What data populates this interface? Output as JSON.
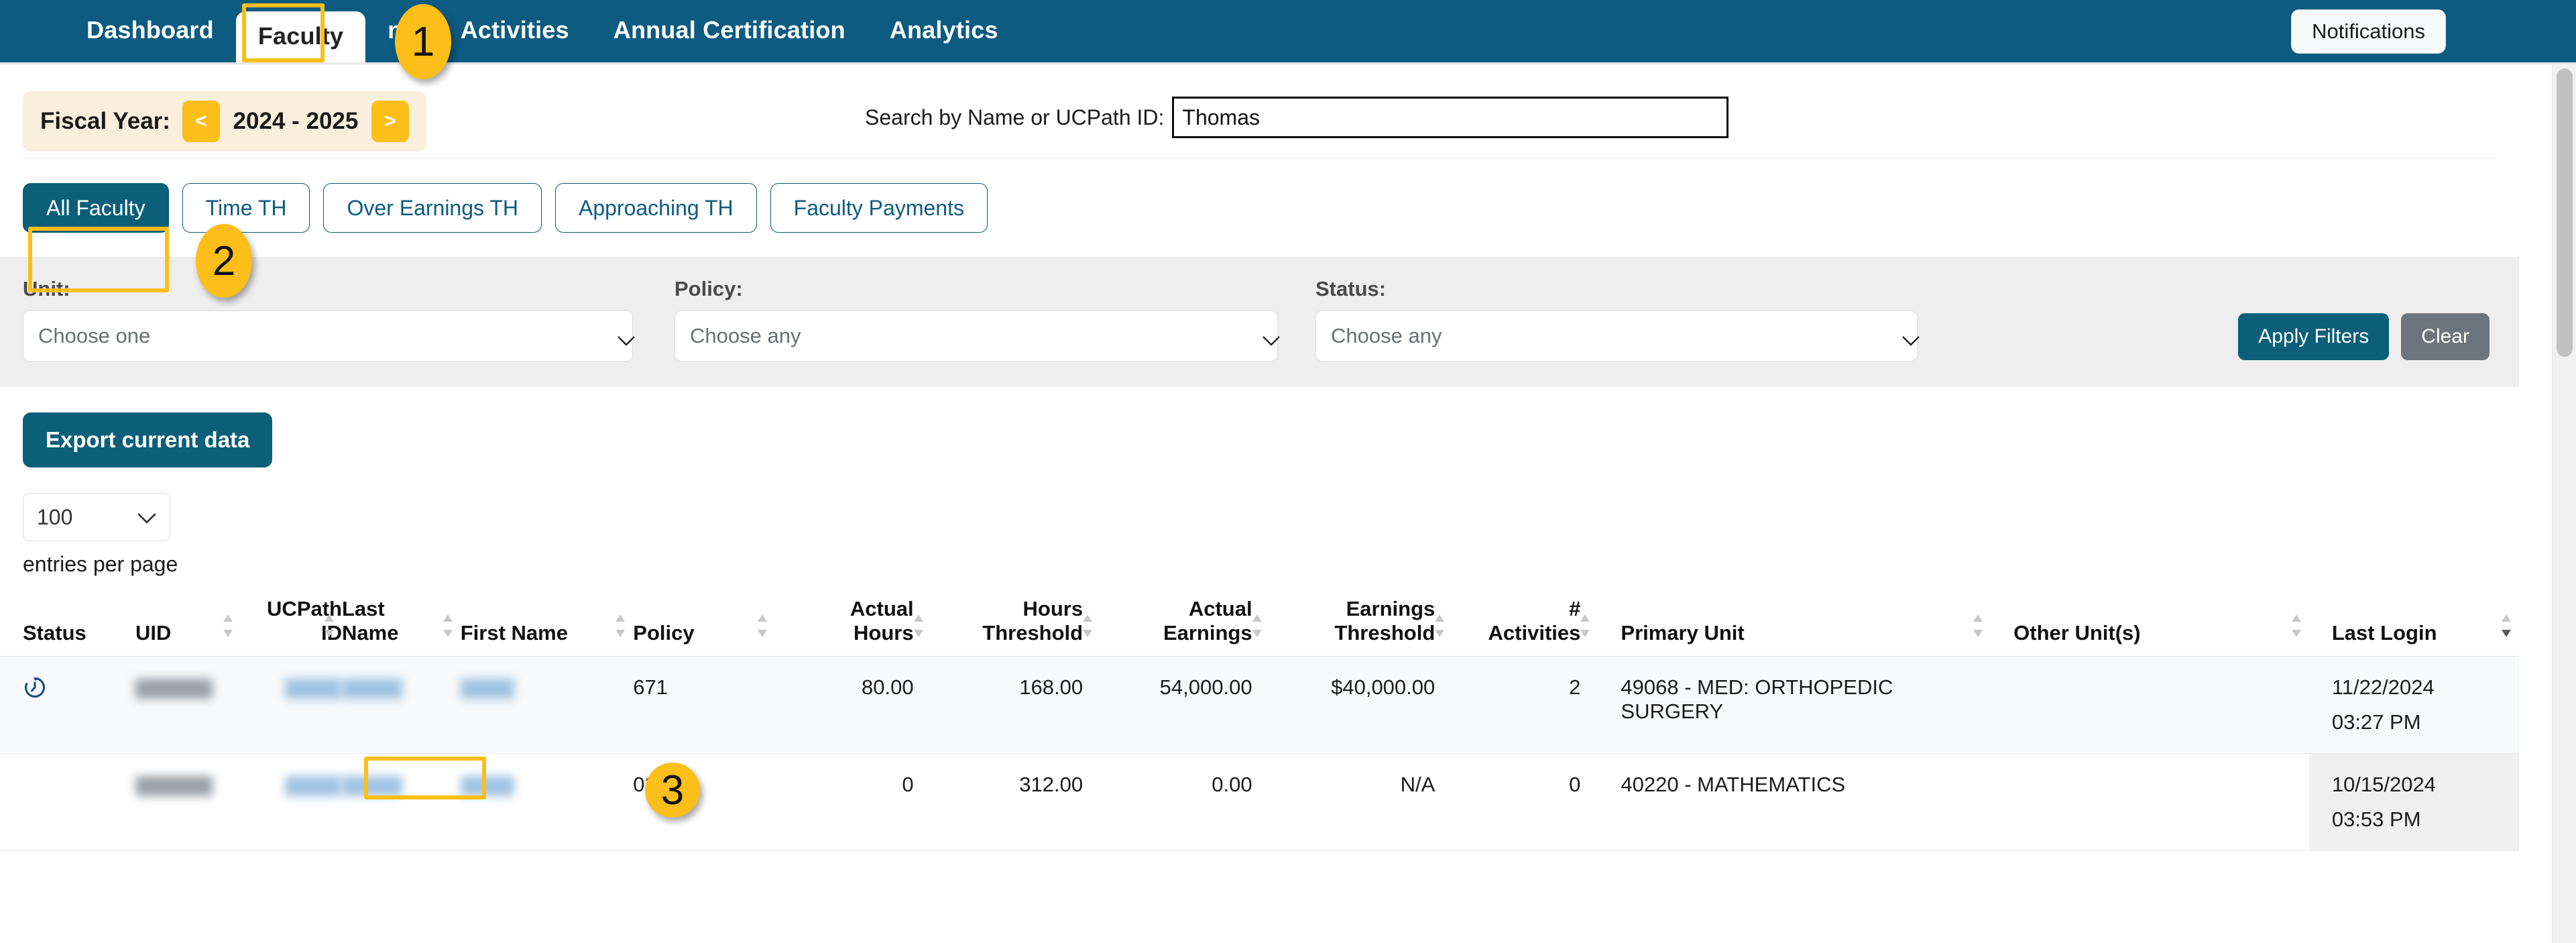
{
  "navbar": {
    "items": [
      {
        "label": "Dashboard",
        "active": false
      },
      {
        "label": "Faculty",
        "active": true
      },
      {
        "label": "ns",
        "active": false
      },
      {
        "label": "Activities",
        "active": false
      },
      {
        "label": "Annual Certification",
        "active": false
      },
      {
        "label": "Analytics",
        "active": false
      }
    ],
    "notifications_label": "Notifications"
  },
  "fiscal_year": {
    "label": "Fiscal Year:",
    "prev": "<",
    "value": "2024 - 2025",
    "next": ">"
  },
  "search": {
    "label": "Search by Name or UCPath ID:",
    "value": "Thomas",
    "placeholder": ""
  },
  "tabs": [
    {
      "label": "All Faculty",
      "active": true
    },
    {
      "label": "Time TH",
      "active": false
    },
    {
      "label": "Over Earnings TH",
      "active": false
    },
    {
      "label": "Approaching TH",
      "active": false
    },
    {
      "label": "Faculty Payments",
      "active": false
    }
  ],
  "filters": {
    "unit": {
      "label": "Unit:",
      "value": "Choose one"
    },
    "policy": {
      "label": "Policy:",
      "value": "Choose any"
    },
    "status": {
      "label": "Status:",
      "value": "Choose any"
    },
    "apply_label": "Apply Filters",
    "clear_label": "Clear"
  },
  "export": {
    "label": "Export current data"
  },
  "pagination": {
    "entries_value": "100",
    "entries_caption": "entries per page"
  },
  "table": {
    "columns": [
      {
        "label": "Status",
        "sortable": false,
        "align": "left"
      },
      {
        "label": "UID",
        "sortable": true,
        "align": "left"
      },
      {
        "label": "UCPath ID",
        "line1": "UCPath",
        "line2": "ID",
        "sortable": true,
        "align": "right"
      },
      {
        "label": "Last Name",
        "line1": "Last",
        "line2": "Name",
        "sortable": true,
        "align": "left"
      },
      {
        "label": "First Name",
        "sortable": true,
        "align": "left"
      },
      {
        "label": "Policy",
        "sortable": true,
        "align": "left"
      },
      {
        "label": "Actual Hours",
        "line1": "Actual",
        "line2": "Hours",
        "sortable": true,
        "align": "right"
      },
      {
        "label": "Hours Threshold",
        "line1": "Hours",
        "line2": "Threshold",
        "sortable": true,
        "align": "right"
      },
      {
        "label": "Actual Earnings",
        "line1": "Actual",
        "line2": "Earnings",
        "sortable": true,
        "align": "right"
      },
      {
        "label": "Earnings Threshold",
        "line1": "Earnings",
        "line2": "Threshold",
        "sortable": true,
        "align": "right"
      },
      {
        "label": "# Activities",
        "line1": "#",
        "line2": "Activities",
        "sortable": true,
        "align": "right"
      },
      {
        "label": "Primary Unit",
        "sortable": true,
        "align": "left"
      },
      {
        "label": "Other Unit(s)",
        "sortable": true,
        "align": "left"
      },
      {
        "label": "Last Login",
        "sortable": true,
        "align": "left"
      }
    ],
    "rows": [
      {
        "status_icon": "clock-icon",
        "uid": "",
        "ucpath_id": "",
        "last_name": "",
        "first_name": "",
        "policy": "671",
        "actual_hours": "80.00",
        "hours_threshold": "168.00",
        "actual_earnings": "54,000.00",
        "earnings_threshold": "$40,000.00",
        "activities": "2",
        "primary_unit": "49068 - MED: ORTHOPEDIC SURGERY",
        "other_units": "",
        "last_login_date": "11/22/2024",
        "last_login_time": "03:27 PM"
      },
      {
        "status_icon": "",
        "uid": "",
        "ucpath_id": "",
        "last_name": "",
        "first_name": "",
        "policy": "025",
        "actual_hours": "0",
        "hours_threshold": "312.00",
        "actual_earnings": "0.00",
        "earnings_threshold": "N/A",
        "activities": "0",
        "primary_unit": "40220 - MATHEMATICS",
        "other_units": "",
        "last_login_date": "10/15/2024",
        "last_login_time": "03:53 PM"
      }
    ]
  },
  "annotations": [
    {
      "number": "1"
    },
    {
      "number": "2"
    },
    {
      "number": "3"
    }
  ],
  "colors": {
    "nav_blue": "#0d5b80",
    "accent_teal": "#0d5f79",
    "highlight_yellow": "#fcbe18",
    "fy_bg": "#faeedd",
    "filter_bg": "#eeeeee"
  }
}
